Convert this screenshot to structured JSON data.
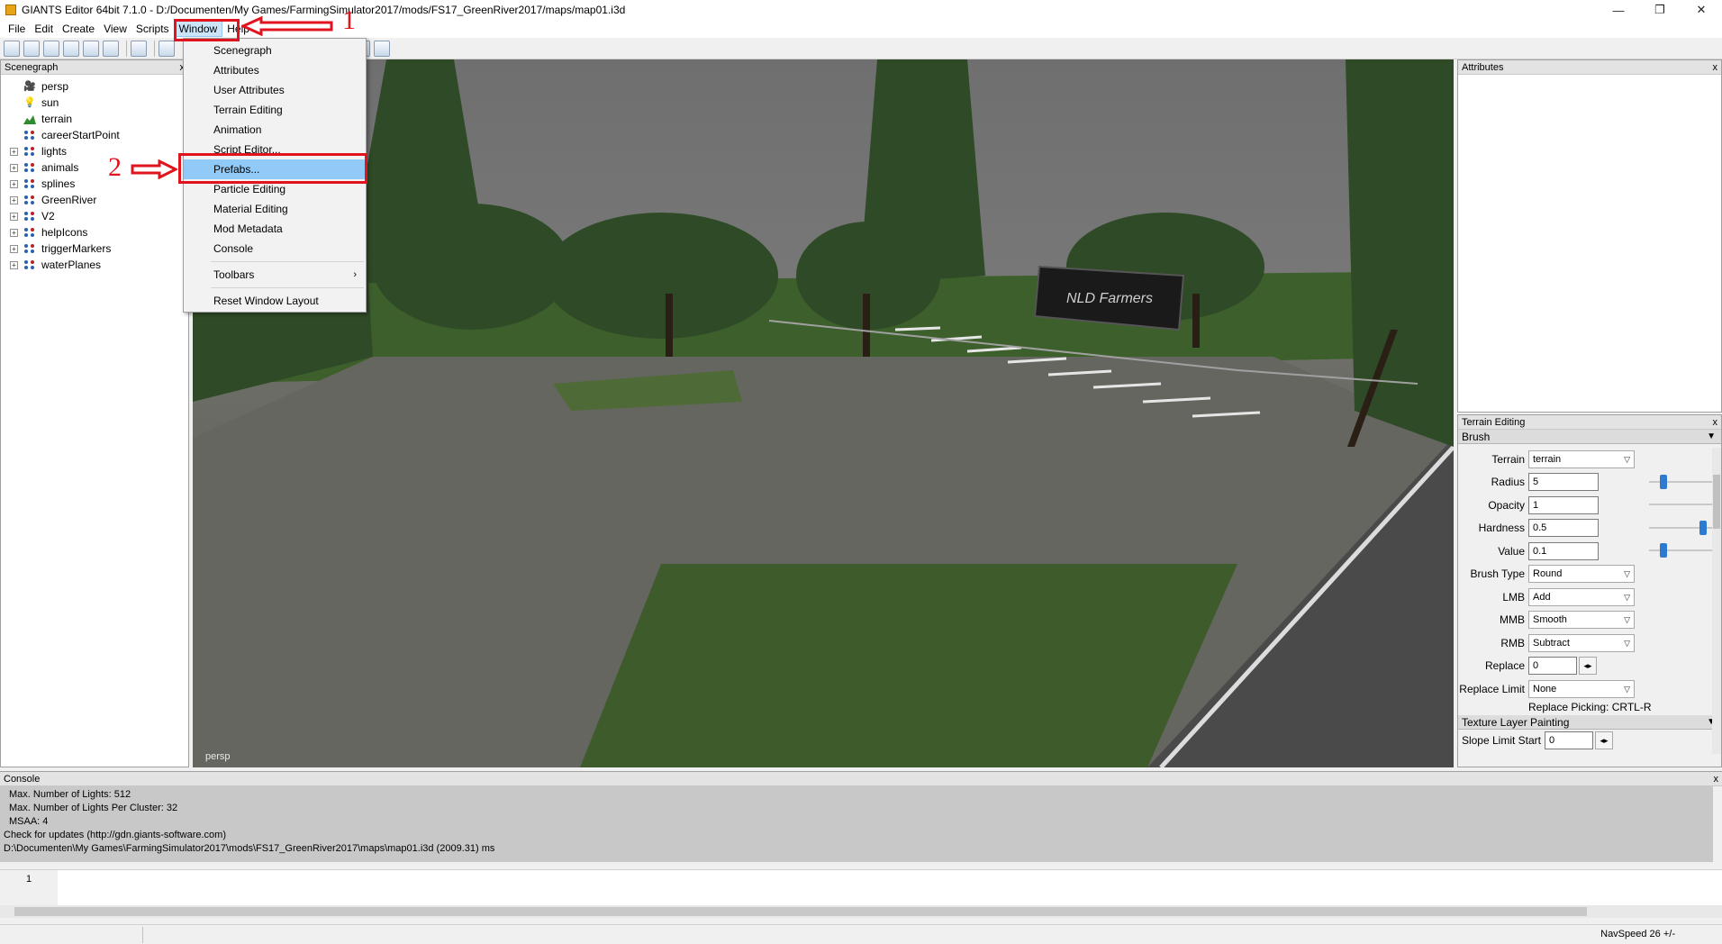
{
  "window": {
    "title": "GIANTS Editor 64bit 7.1.0 - D:/Documenten/My Games/FarmingSimulator2017/mods/FS17_GreenRiver2017/maps/map01.i3d",
    "minimize": "—",
    "restore": "❐",
    "close": "✕"
  },
  "menubar": [
    "File",
    "Edit",
    "Create",
    "View",
    "Scripts",
    "Window",
    "Help"
  ],
  "window_menu": {
    "items": [
      "Scenegraph",
      "Attributes",
      "User Attributes",
      "Terrain Editing",
      "Animation",
      "Script Editor...",
      "Prefabs...",
      "Particle Editing",
      "Material Editing",
      "Mod Metadata",
      "Console"
    ],
    "toolbars": "Toolbars",
    "reset": "Reset Window Layout",
    "highlighted": "Prefabs..."
  },
  "annotations": {
    "step1": "1",
    "step2": "2"
  },
  "scenegraph": {
    "title": "Scenegraph",
    "close": "x",
    "nodes": [
      {
        "label": "persp",
        "icon": "camera-icon"
      },
      {
        "label": "sun",
        "icon": "light-bulb-icon"
      },
      {
        "label": "terrain",
        "icon": "terrain-icon"
      },
      {
        "label": "careerStartPoint",
        "icon": "transform-group-icon"
      },
      {
        "label": "lights",
        "icon": "transform-group-icon"
      },
      {
        "label": "animals",
        "icon": "transform-group-icon"
      },
      {
        "label": "splines",
        "icon": "transform-group-icon"
      },
      {
        "label": "GreenRiver",
        "icon": "transform-group-icon"
      },
      {
        "label": "V2",
        "icon": "transform-group-icon"
      },
      {
        "label": "helpIcons",
        "icon": "transform-group-icon"
      },
      {
        "label": "triggerMarkers",
        "icon": "transform-group-icon"
      },
      {
        "label": "waterPlanes",
        "icon": "transform-group-icon"
      }
    ]
  },
  "viewport": {
    "camera_label": "persp",
    "billboard_text": "NLD Farmers"
  },
  "attributes": {
    "title": "Attributes",
    "close": "x"
  },
  "terrain_editing": {
    "title": "Terrain Editing",
    "close": "x",
    "brush_section": "Brush",
    "terrain_label": "Terrain",
    "terrain_value": "terrain",
    "radius_label": "Radius",
    "radius_value": "5",
    "radius_level": 0.2,
    "opacity_label": "Opacity",
    "opacity_value": "1",
    "hardness_label": "Hardness",
    "hardness_value": "0.5",
    "hardness_level": 0.9,
    "value_label": "Value",
    "value_value": "0.1",
    "value_level": 0.2,
    "brush_type_label": "Brush Type",
    "brush_type_value": "Round",
    "lmb_label": "LMB",
    "lmb_value": "Add",
    "mmb_label": "MMB",
    "mmb_value": "Smooth",
    "rmb_label": "RMB",
    "rmb_value": "Subtract",
    "replace_label": "Replace",
    "replace_value": "0",
    "replace_limit_label": "Replace Limit",
    "replace_limit_value": "None",
    "replace_picking": "Replace Picking: CRTL-R",
    "texture_section": "Texture Layer Painting",
    "slope_label": "Slope Limit Start",
    "slope_value": "0"
  },
  "console": {
    "title": "Console",
    "close": "x",
    "lines": [
      "Max. Number of Lights: 512",
      "Max. Number of Lights Per Cluster: 32",
      "MSAA: 4",
      "Check for updates (http://gdn.giants-software.com)",
      "D:\\Documenten\\My Games\\FarmingSimulator2017\\mods\\FS17_GreenRiver2017\\maps\\map01.i3d (2009.31) ms"
    ],
    "line_number": "1"
  },
  "status": {
    "navspeed": "NavSpeed 26 +/-"
  },
  "colors": {
    "annotation_red": "#e0141e",
    "menu_highlight": "#91c9f7",
    "slider_blue": "#2d7bd0"
  }
}
